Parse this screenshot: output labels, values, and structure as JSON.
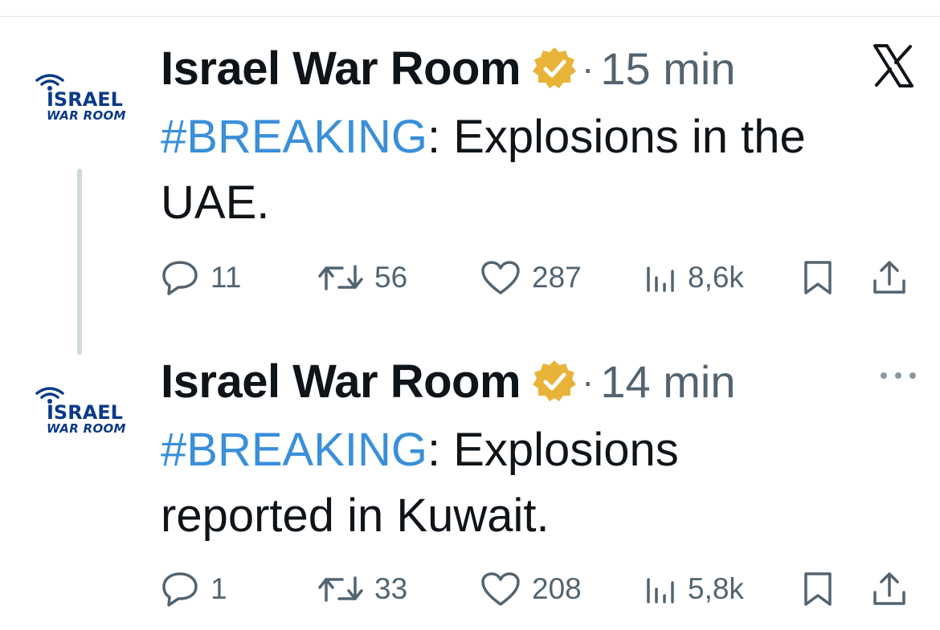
{
  "tweets": [
    {
      "author": "Israel War Room",
      "avatar_text_1": "ISRAEL",
      "avatar_text_2": "WAR ROOM",
      "separator": "·",
      "time": "15 min",
      "hashtag": "#BREAKING",
      "text_line1": ": Explosions in the",
      "text_line2": "UAE.",
      "replies": "11",
      "reposts": "56",
      "likes": "287",
      "views": "8,6k"
    },
    {
      "author": "Israel War Room",
      "avatar_text_1": "ISRAEL",
      "avatar_text_2": "WAR ROOM",
      "separator": "·",
      "time": "14 min",
      "hashtag": "#BREAKING",
      "text_line1": ": Explosions",
      "text_line2": "reported in Kuwait.",
      "replies": "1",
      "reposts": "33",
      "likes": "208",
      "views": "5,8k"
    }
  ],
  "icons": {
    "platform_logo": "x-logo-icon",
    "verified": "verified-badge-icon",
    "more": "more-icon",
    "reply": "reply-icon",
    "repost": "repost-icon",
    "like": "heart-icon",
    "views": "views-icon",
    "bookmark": "bookmark-icon",
    "share": "share-icon"
  },
  "colors": {
    "hashtag": "#3a8fd9",
    "verified_badge": "#e8b339",
    "secondary_text": "#536471",
    "logo_blue": "#0b3a86"
  }
}
